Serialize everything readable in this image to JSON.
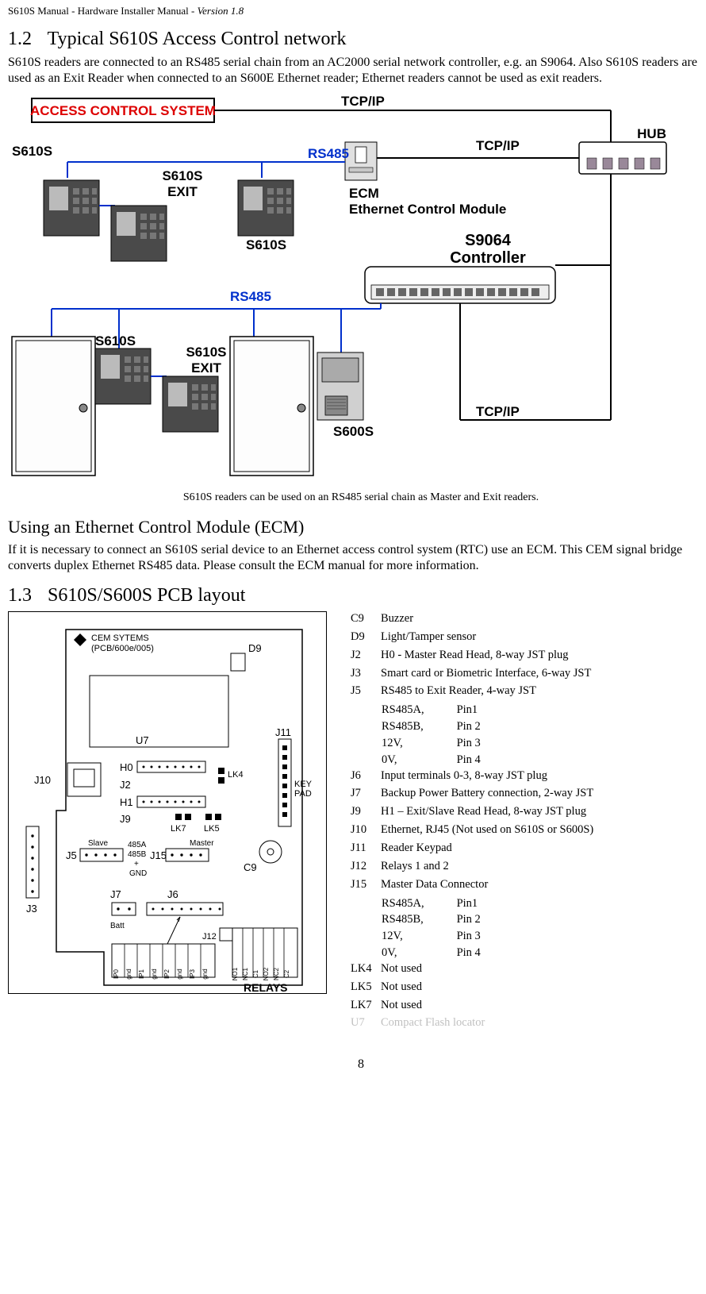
{
  "doc": {
    "header_left": "S610S Manual  - Hardware Installer Manual  - ",
    "header_version": "Version 1.8",
    "pagenum": "8"
  },
  "sec12": {
    "num": "1.2",
    "title": "Typical S610S Access Control network",
    "para": "S610S readers are connected to an RS485 serial chain from an AC2000 serial network controller, e.g. an S9064.  Also S610S readers are used as an Exit Reader when connected to an S600E Ethernet reader; Ethernet readers cannot be used as exit readers."
  },
  "fig": {
    "box_label": "ACCESS CONTROL SYSTEM",
    "tcpip": "TCP/IP",
    "rs485": "RS485",
    "hub": "HUB",
    "s610s": "S610S",
    "s610s_exit_a": "S610S",
    "s610s_exit_b": "EXIT",
    "s600s": "S600S",
    "ecm_a": "ECM",
    "ecm_b": "Ethernet Control Module",
    "sctrl_a": "S9064",
    "sctrl_b": "Controller",
    "caption": "S610S readers can be used on an RS485 serial chain as Master and Exit readers."
  },
  "ecm": {
    "head": "Using an Ethernet Control Module (ECM)",
    "para": "If it is necessary to connect an S610S serial device to an Ethernet access control system (RTC) use an ECM.  This CEM signal bridge converts duplex Ethernet RS485 data.  Please consult the ECM manual for more information."
  },
  "sec13": {
    "num": "1.3",
    "title": "S610S/S600S PCB layout"
  },
  "pcb_labels": {
    "vendor_a": "CEM SYTEMS",
    "vendor_b": "(PCB/600e/005)",
    "D9": "D9",
    "U7": "U7",
    "J10": "J10",
    "H0": "H0",
    "J2": "J2",
    "H1": "H1",
    "J9": "J9",
    "LK4": "LK4",
    "LK7": "LK7",
    "LK5": "LK5",
    "J11": "J11",
    "keypad_a": "KEY",
    "keypad_b": "PAD",
    "slave": "Slave",
    "master": "Master",
    "a485a": "485A",
    "a485b": "485B",
    "plus": "+",
    "gnd": "GND",
    "J5": "J5",
    "J15": "J15",
    "C9": "C9",
    "J7": "J7",
    "J6": "J6",
    "Batt": "Batt",
    "J3": "J3",
    "J12": "J12",
    "relays": "RELAYS",
    "IP0": "IP0",
    "gnd2": "gnd",
    "IP1": "IP1",
    "IP2": "IP2",
    "IP3": "IP3",
    "NO1": "NO1",
    "NC1": "NC1",
    "C1": "C1",
    "NO2": "NO2",
    "NC2": "NC2",
    "C2": "C2"
  },
  "key": {
    "c9": "Buzzer",
    "d9": "Light/Tamper sensor",
    "j2": "H0 - Master Read Head, 8-way JST plug",
    "j3": "Smart card or Biometric Interface, 6-way JST",
    "j5": "RS485 to Exit Reader, 4-way JST",
    "j5_pins": {
      "a": "RS485A,",
      "ap": "Pin1",
      "b": "RS485B,",
      "bp": "Pin 2",
      "c": "12V,",
      "cp": "Pin 3",
      "d": "0V,",
      "dp": "Pin 4"
    },
    "j6": "Input terminals 0-3, 8-way JST plug",
    "j7": "Backup Power Battery connection, 2-way JST",
    "j9": "H1 – Exit/Slave Read Head, 8-way JST plug",
    "j10": "Ethernet, RJ45 (Not used on S610S or S600S)",
    "j11": "Reader Keypad",
    "j12": "Relays 1 and 2",
    "j15": "Master Data Connector",
    "j15_pins": {
      "a": "RS485A,",
      "ap": "Pin1",
      "b": "RS485B,",
      "bp": "Pin 2",
      "c": "12V,",
      "cp": "Pin 3",
      "d": "0V,",
      "dp": "Pin 4"
    },
    "lk4": "Not used",
    "lk5": "Not used",
    "lk7": "Not used",
    "u7": "Compact Flash locator"
  }
}
